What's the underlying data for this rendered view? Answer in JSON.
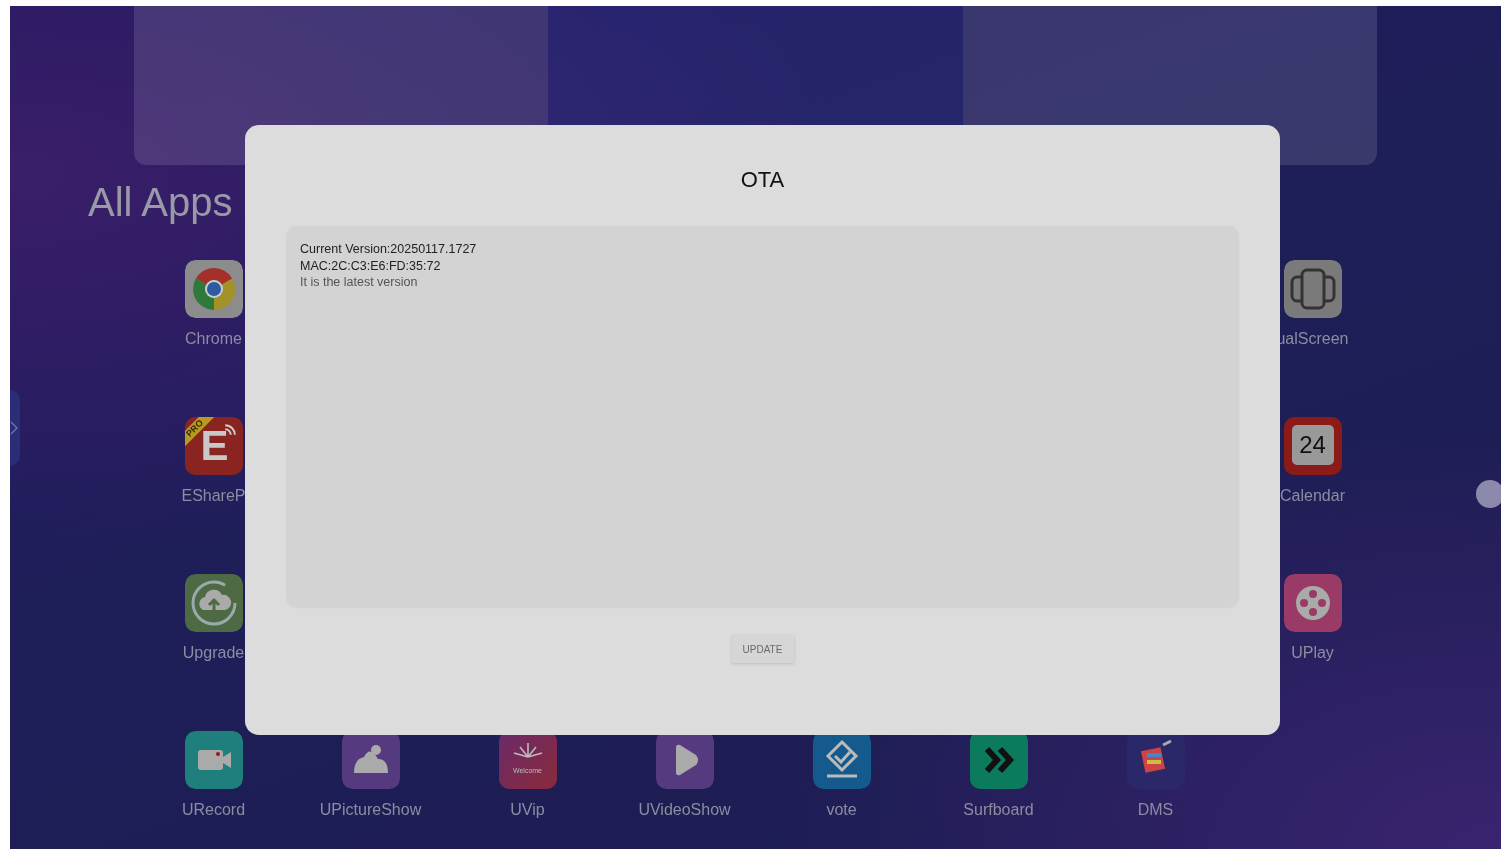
{
  "launcher": {
    "title": "All Apps",
    "left_column": [
      {
        "kind": "chrome",
        "label": "Chrome"
      },
      {
        "kind": "eshare",
        "label": "EShareP",
        "icon_text": "E",
        "badge": "PRO"
      },
      {
        "kind": "upgrade",
        "label": "Upgrade"
      }
    ],
    "right_column": [
      {
        "kind": "dualscreen",
        "label": "ualScreen"
      },
      {
        "kind": "calendar",
        "label": "Calendar",
        "icon_text": "24"
      },
      {
        "kind": "uplay",
        "label": "UPlay"
      }
    ],
    "bottom_row": [
      {
        "kind": "record",
        "label": "URecord"
      },
      {
        "kind": "picture",
        "label": "UPictureShow"
      },
      {
        "kind": "uvip",
        "label": "UVip",
        "icon_text": "Welcome"
      },
      {
        "kind": "video",
        "label": "UVideoShow"
      },
      {
        "kind": "vote",
        "label": "vote"
      },
      {
        "kind": "surfboard",
        "label": "Surfboard"
      },
      {
        "kind": "dms",
        "label": "DMS"
      }
    ]
  },
  "dialog": {
    "title": "OTA",
    "lines": [
      {
        "kind": "info",
        "text": "Current Version:20250117.1727"
      },
      {
        "kind": "info",
        "text": "MAC:2C:C3:E6:FD:35:72"
      },
      {
        "kind": "status",
        "text": "It is the latest version"
      }
    ],
    "button": {
      "label": "UPDATE",
      "disabled": true
    }
  }
}
